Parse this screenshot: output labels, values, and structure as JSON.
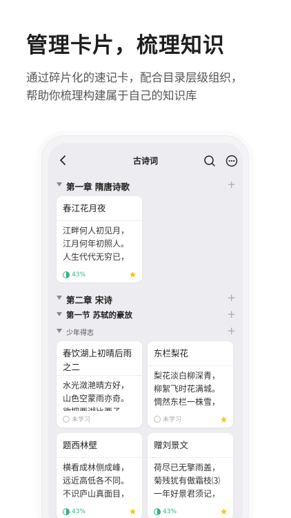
{
  "headline": "管理卡片，梳理知识",
  "subline": [
    "通过碎片化的速记卡，配合目录层级组织，",
    "帮助你梳理构建属于自己的知识库"
  ],
  "nav": {
    "title": "古诗词"
  },
  "outline": {
    "chapter1": "第一章 隋唐诗歌",
    "chapter2": "第二章 宋诗",
    "section1": "第一节 苏轼的豪放",
    "sub1": "少年得志",
    "plus": "+"
  },
  "colors": {
    "accent": "#2fb67f",
    "star": "#f5c518"
  },
  "cards": [
    {
      "title": "春江花月夜",
      "lines": [
        "江畔何人初见月，",
        "江月何年初照人。",
        "人生代代无穷已，"
      ],
      "status": "43%",
      "starred": true
    },
    {
      "title": "春饮湖上初晴后雨之二",
      "lines": [
        "水光潋滟晴方好，",
        "山色空蒙雨亦奇。",
        "欲把西湖比西子，"
      ],
      "status": "未学习",
      "starred": false
    },
    {
      "title": "东栏梨花",
      "lines": [
        "梨花淡白柳深青，",
        "柳絮飞时花满城。",
        "惆然东栏一株雪，"
      ],
      "status": "未学习",
      "starred": true
    },
    {
      "title": "题西林壁",
      "lines": [
        "横看成林侧成峰，",
        "远近高低各不同。",
        "不识庐山真面目，"
      ],
      "status": "43%",
      "starred": true
    },
    {
      "title": "赠刘景文",
      "lines": [
        "荷尽已无擎雨盖，",
        "菊残犹有傲霜枝⑶",
        "一年好景君须记，"
      ],
      "status": "43%",
      "starred": true
    }
  ]
}
